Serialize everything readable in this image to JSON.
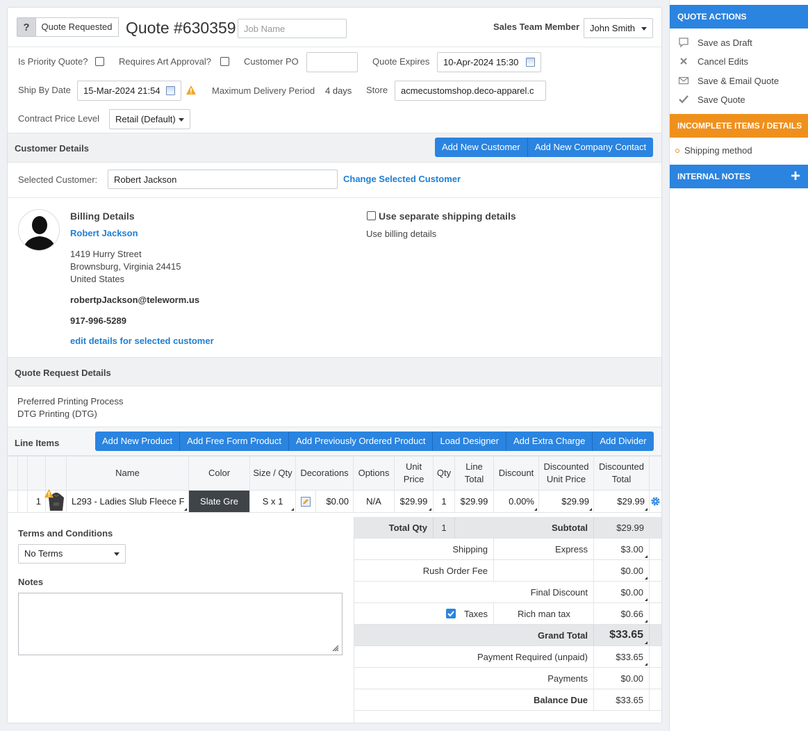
{
  "header": {
    "help_badge": "?",
    "status": "Quote Requested",
    "quote_title": "Quote #630359",
    "job_name_placeholder": "Job Name",
    "sales_team_label": "Sales Team Member",
    "sales_team_value": "John Smith"
  },
  "form": {
    "priority_label": "Is Priority Quote?",
    "art_approval_label": "Requires Art Approval?",
    "customer_po_label": "Customer PO",
    "customer_po_value": "",
    "quote_expires_label": "Quote Expires",
    "quote_expires_value": "10-Apr-2024 15:30",
    "ship_by_label": "Ship By Date",
    "ship_by_value": "15-Mar-2024 21:54",
    "max_delivery_label": "Maximum Delivery Period",
    "max_delivery_value": "4 days",
    "store_label": "Store",
    "store_value": "acmecustomshop.deco-apparel.c",
    "price_level_label": "Contract Price Level",
    "price_level_value": "Retail (Default)"
  },
  "customer": {
    "section_title": "Customer Details",
    "add_customer": "Add New Customer",
    "add_contact": "Add New Company Contact",
    "selected_label": "Selected Customer:",
    "selected_value": "Robert Jackson",
    "change_link": "Change Selected Customer",
    "billing_title": "Billing Details",
    "name": "Robert Jackson",
    "address1": "1419 Hurry Street",
    "address2": "Brownsburg, Virginia 24415",
    "address3": "United States",
    "email": "robertpJackson@teleworm.us",
    "phone": "917-996-5289",
    "edit_link": "edit details for selected customer",
    "separate_shipping": "Use separate shipping details",
    "use_billing": "Use billing details"
  },
  "request": {
    "section_title": "Quote Request Details",
    "process_label": "Preferred Printing Process",
    "process_value": "DTG Printing (DTG)"
  },
  "line_items": {
    "section_title": "Line Items",
    "buttons": [
      "Add New Product",
      "Add Free Form Product",
      "Add Previously Ordered Product",
      "Load Designer",
      "Add Extra Charge",
      "Add Divider"
    ],
    "columns": {
      "name": "Name",
      "color": "Color",
      "size": "Size / Qty",
      "decorations": "Decorations",
      "options": "Options",
      "unit_price_1": "Unit",
      "unit_price_2": "Price",
      "qty": "Qty",
      "line_total_1": "Line",
      "line_total_2": "Total",
      "discount": "Discount",
      "disc_unit_1": "Discounted",
      "disc_unit_2": "Unit Price",
      "disc_total_1": "Discounted",
      "disc_total_2": "Total"
    },
    "rows": [
      {
        "num": "1",
        "name": "L293 - Ladies Slub Fleece F",
        "color": "Slate Gre",
        "size": "S x 1",
        "decoration_price": "$0.00",
        "options": "N/A",
        "unit_price": "$29.99",
        "qty": "1",
        "line_total": "$29.99",
        "discount": "0.00%",
        "disc_unit": "$29.99",
        "disc_total": "$29.99"
      }
    ]
  },
  "terms": {
    "terms_label": "Terms and Conditions",
    "terms_value": "No Terms",
    "notes_label": "Notes"
  },
  "totals": {
    "total_qty_label": "Total Qty",
    "total_qty": "1",
    "subtotal_label": "Subtotal",
    "subtotal": "$29.99",
    "shipping_label": "Shipping",
    "shipping_method": "Express",
    "shipping": "$3.00",
    "rush_label": "Rush Order Fee",
    "rush": "$0.00",
    "final_discount_label": "Final Discount",
    "final_discount": "$0.00",
    "taxes_label": "Taxes",
    "tax_name": "Rich man tax",
    "taxes": "$0.66",
    "grand_total_label": "Grand Total",
    "grand_total": "$33.65",
    "payment_required_label": "Payment Required (unpaid)",
    "payment_required": "$33.65",
    "payments_label": "Payments",
    "payments": "$0.00",
    "balance_label": "Balance Due",
    "balance": "$33.65"
  },
  "sidebar": {
    "actions_title": "QUOTE ACTIONS",
    "save_draft": "Save as Draft",
    "cancel_edits": "Cancel Edits",
    "save_email": "Save & Email Quote",
    "save_quote": "Save Quote",
    "incomplete_title": "INCOMPLETE ITEMS / DETAILS",
    "incomplete_item": "Shipping method",
    "notes_title": "INTERNAL NOTES",
    "notes_add": "+"
  },
  "colors": {
    "primary": "#2a84e0",
    "orange": "#f0901c",
    "swatch": "#3f4449"
  }
}
